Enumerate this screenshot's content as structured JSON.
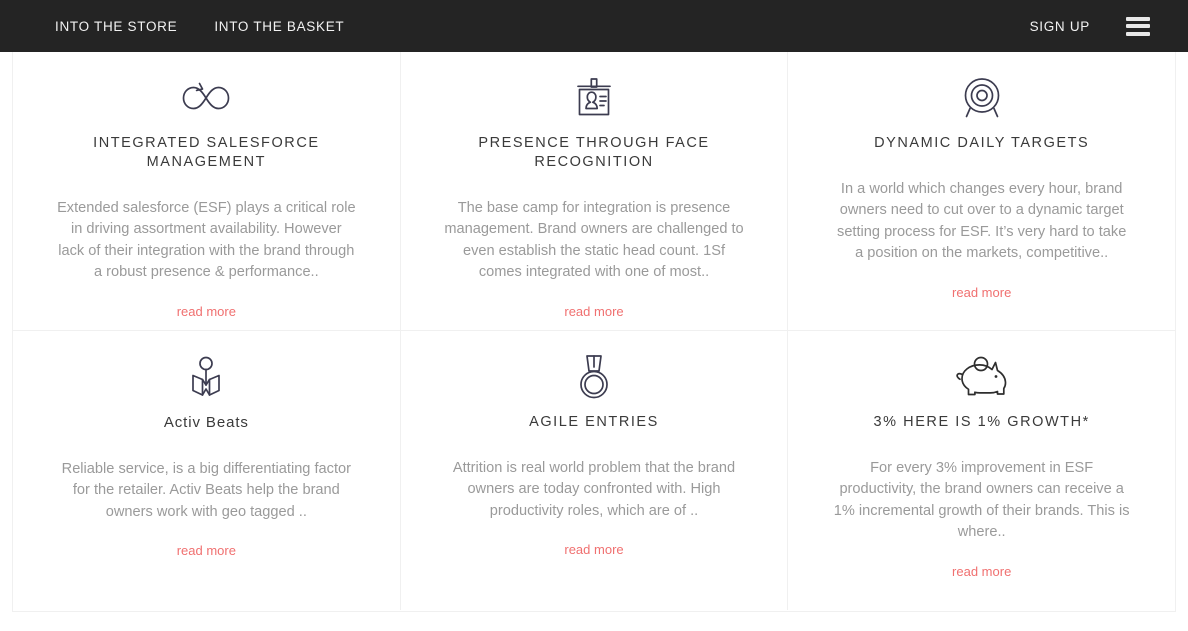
{
  "navbar": {
    "links": [
      {
        "label": "INTO THE STORE",
        "name": "nav-link-into-the-store"
      },
      {
        "label": "INTO THE BASKET",
        "name": "nav-link-into-the-basket"
      }
    ],
    "signup_label": "SIGN UP",
    "menu_icon": "hamburger-menu-icon",
    "background_color": "#242424",
    "text_color": "#f2f2f2"
  },
  "theme": {
    "accent_color": "#f07070",
    "border_color": "#f0f0f0",
    "title_color": "#3a3a3a",
    "body_color": "#9a9a9a",
    "page_background": "#ffffff"
  },
  "read_more_label": "read more",
  "cards": [
    {
      "icon": "infinity-arrow-icon",
      "title": "INTEGRATED SALESFORCE MANAGEMENT",
      "body": "Extended salesforce (ESF) plays a critical role in driving assortment availability. However lack of their integration with the brand through a robust presence & performance..",
      "link_label": "read more"
    },
    {
      "icon": "id-badge-icon",
      "title": "PRESENCE THROUGH FACE RECOGNITION",
      "body": "The base camp for integration is presence management. Brand owners are challenged to even establish the static head count. 1Sf comes integrated with one of most..",
      "link_label": "read more"
    },
    {
      "icon": "target-bullseye-icon",
      "title": "DYNAMIC DAILY TARGETS",
      "body": "In a world which changes every hour, brand owners need to cut over to a dynamic target setting process for ESF. It’s very hard to take a position on the markets, competitive..",
      "link_label": "read more"
    },
    {
      "icon": "map-pin-icon",
      "title": "Activ Beats",
      "body": "Reliable service, is a big differentiating factor for the retailer. Activ Beats help the brand owners work with geo tagged ..",
      "link_label": "read more"
    },
    {
      "icon": "medal-icon",
      "title": "AGILE ENTRIES",
      "body": "Attrition is real world problem that the brand owners are today confronted with. High productivity roles, which are of ..",
      "link_label": "read more"
    },
    {
      "icon": "piggy-bank-icon",
      "title": "3% HERE IS 1% GROWTH*",
      "body": "For every 3% improvement in ESF productivity, the brand owners can receive a 1% incremental growth of their brands. This is where..",
      "link_label": "read more"
    }
  ]
}
